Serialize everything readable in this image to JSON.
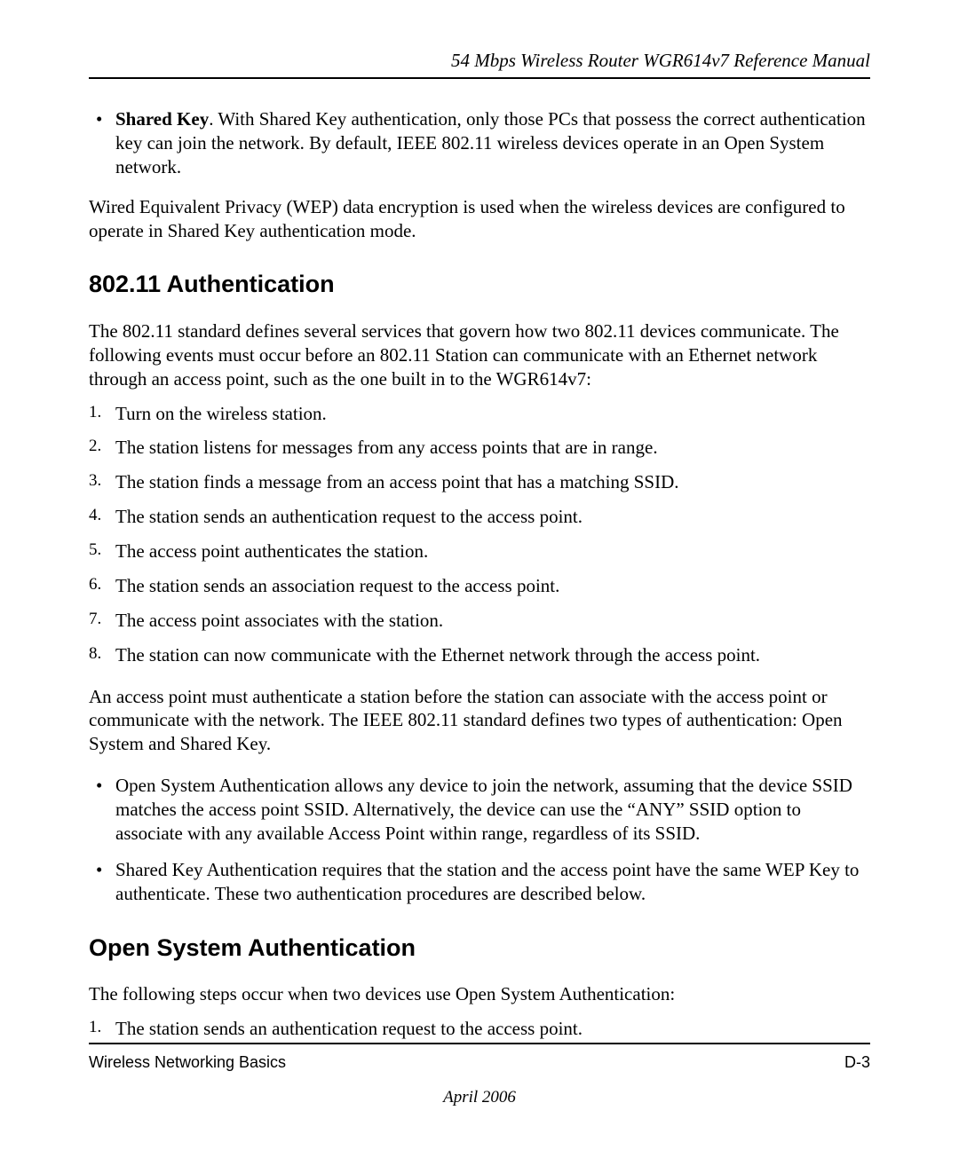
{
  "header": {
    "running": "54 Mbps Wireless Router WGR614v7 Reference Manual"
  },
  "sharedKeyBullet": {
    "lead": "Shared Key",
    "rest": ". With Shared Key authentication, only those PCs that possess the correct authentication key can join the network. By default, IEEE 802.11 wireless devices operate in an Open System network."
  },
  "wepPara": "Wired Equivalent Privacy (WEP) data encryption is used when the wireless devices are configured to operate in Shared Key authentication mode.",
  "section1": {
    "title": "802.11 Authentication",
    "intro": "The 802.11 standard defines several services that govern how two 802.11 devices communicate. The following events must occur before an 802.11 Station can communicate with an Ethernet network through an access point, such as the one built in to the WGR614v7:",
    "steps": [
      "Turn on the wireless station.",
      "The station listens for messages from any access points that are in range.",
      "The station finds a message from an access point that has a matching SSID.",
      "The station sends an authentication request to the access point.",
      "The access point authenticates the station.",
      "The station sends an association request to the access point.",
      "The access point associates with the station.",
      "The station can now communicate with the Ethernet network through the access point."
    ],
    "para2": "An access point must authenticate a station before the station can associate with the access point or communicate with the network. The IEEE 802.11 standard defines two types of authentication: Open System and Shared Key.",
    "bullets": [
      "Open System Authentication allows any device to join the network, assuming that the device SSID matches the access point SSID. Alternatively, the device can use the “ANY” SSID option to associate with any available Access Point within range, regardless of its SSID.",
      "Shared Key Authentication requires that the station and the access point have the same WEP Key to authenticate. These two authentication procedures are described below."
    ]
  },
  "section2": {
    "title": "Open System Authentication",
    "intro": "The following steps occur when two devices use Open System Authentication:",
    "steps": [
      "The station sends an authentication request to the access point."
    ]
  },
  "footer": {
    "left": "Wireless Networking Basics",
    "right": "D-3",
    "date": "April 2006"
  }
}
